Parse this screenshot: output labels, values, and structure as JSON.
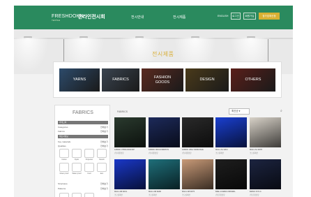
{
  "header": {
    "logo": "FRESHDOKN",
    "logo_sub": "TEXTILE",
    "logo_kr": "온라인전시회",
    "nav": [
      "전시안내",
      "전시제품"
    ],
    "top_link": "ENGLISH",
    "buttons": [
      "로그인",
      "회원가입",
      "참가업체신청"
    ]
  },
  "gallery": {
    "title": "전시제품"
  },
  "categories": [
    {
      "label": "YARNS",
      "color": "#2d4b6b"
    },
    {
      "label": "FABRICS",
      "color": "#3a4450"
    },
    {
      "label": "FASHION\nGOODS",
      "color": "#5a2a20"
    },
    {
      "label": "DESIGN",
      "color": "#4a3a1a"
    },
    {
      "label": "OTHERS",
      "color": "#5a1f1a"
    }
  ],
  "sidebar": {
    "title": "FABRICS",
    "sections": [
      {
        "label": "카테고리"
      },
      {
        "label": "제조사정보"
      }
    ],
    "rows": [
      {
        "label": "Categories",
        "value": "전체보기"
      },
      {
        "label": "Fabrics",
        "value": "전체보기"
      },
      {
        "label": "Key materials",
        "value": "전체보기"
      },
      {
        "label": "Qualities",
        "value": "전체보기"
      }
    ],
    "icons": [
      {
        "label": "Cotton",
        "icon": "cotton-icon"
      },
      {
        "label": "Nylon",
        "icon": "nylon-icon"
      },
      {
        "label": "Polyester",
        "icon": "polyester-icon"
      },
      {
        "label": "Stretch",
        "icon": "stretch-icon"
      },
      {
        "label": "Down proof",
        "icon": "downproof-icon"
      },
      {
        "label": "Water proof",
        "icon": "waterproof-icon"
      },
      {
        "label": "Cool",
        "icon": "cool-icon"
      },
      {
        "label": "Eco",
        "icon": "eco-icon"
      }
    ],
    "bottom_rows": [
      {
        "label": "Structures",
        "value": "전체보기"
      },
      {
        "label": "Patterns",
        "value": "전체보기"
      }
    ]
  },
  "list": {
    "breadcrumb": "FABRICS",
    "sort": "최신순",
    "search_icon": "search-icon"
  },
  "products": [
    {
      "name": "FABRIC 0TBR-M10RJ4P",
      "company": "(주)대원섬유",
      "color": "#2a3a2e"
    },
    {
      "name": "FABRIC 9NFJUSBNPOS",
      "company": "(주)대원섬유",
      "color": "#1d2a5a"
    },
    {
      "name": "FABRIC 4PEJ NDRF2SAE",
      "company": "(주)대원섬유",
      "color": "#2a2a2a"
    },
    {
      "name": "MG11-S1 32K2",
      "company": "코오롱패션",
      "color": "#1a3fd0"
    },
    {
      "name": "MG11-S1 3DT8",
      "company": "코오롱패션",
      "color": "#d8d2c8"
    },
    {
      "name": "MG11-N8 3DK1",
      "company": "코오롱패션",
      "color": "#1a38c8"
    },
    {
      "name": "MG11-N8 3E68",
      "company": "코오롱패션",
      "color": "#1f6f7a"
    },
    {
      "name": "MG11-N8 3DT5",
      "company": "코오롱패션",
      "color": "#c89a78"
    },
    {
      "name": "BRE-4 FABRIC BRN9RL",
      "company": "(주)한창섬유",
      "color": "#1e1e1e"
    },
    {
      "name": "BMNN 72T4 K",
      "company": "(주)한창섬유",
      "color": "#1c2440"
    }
  ]
}
